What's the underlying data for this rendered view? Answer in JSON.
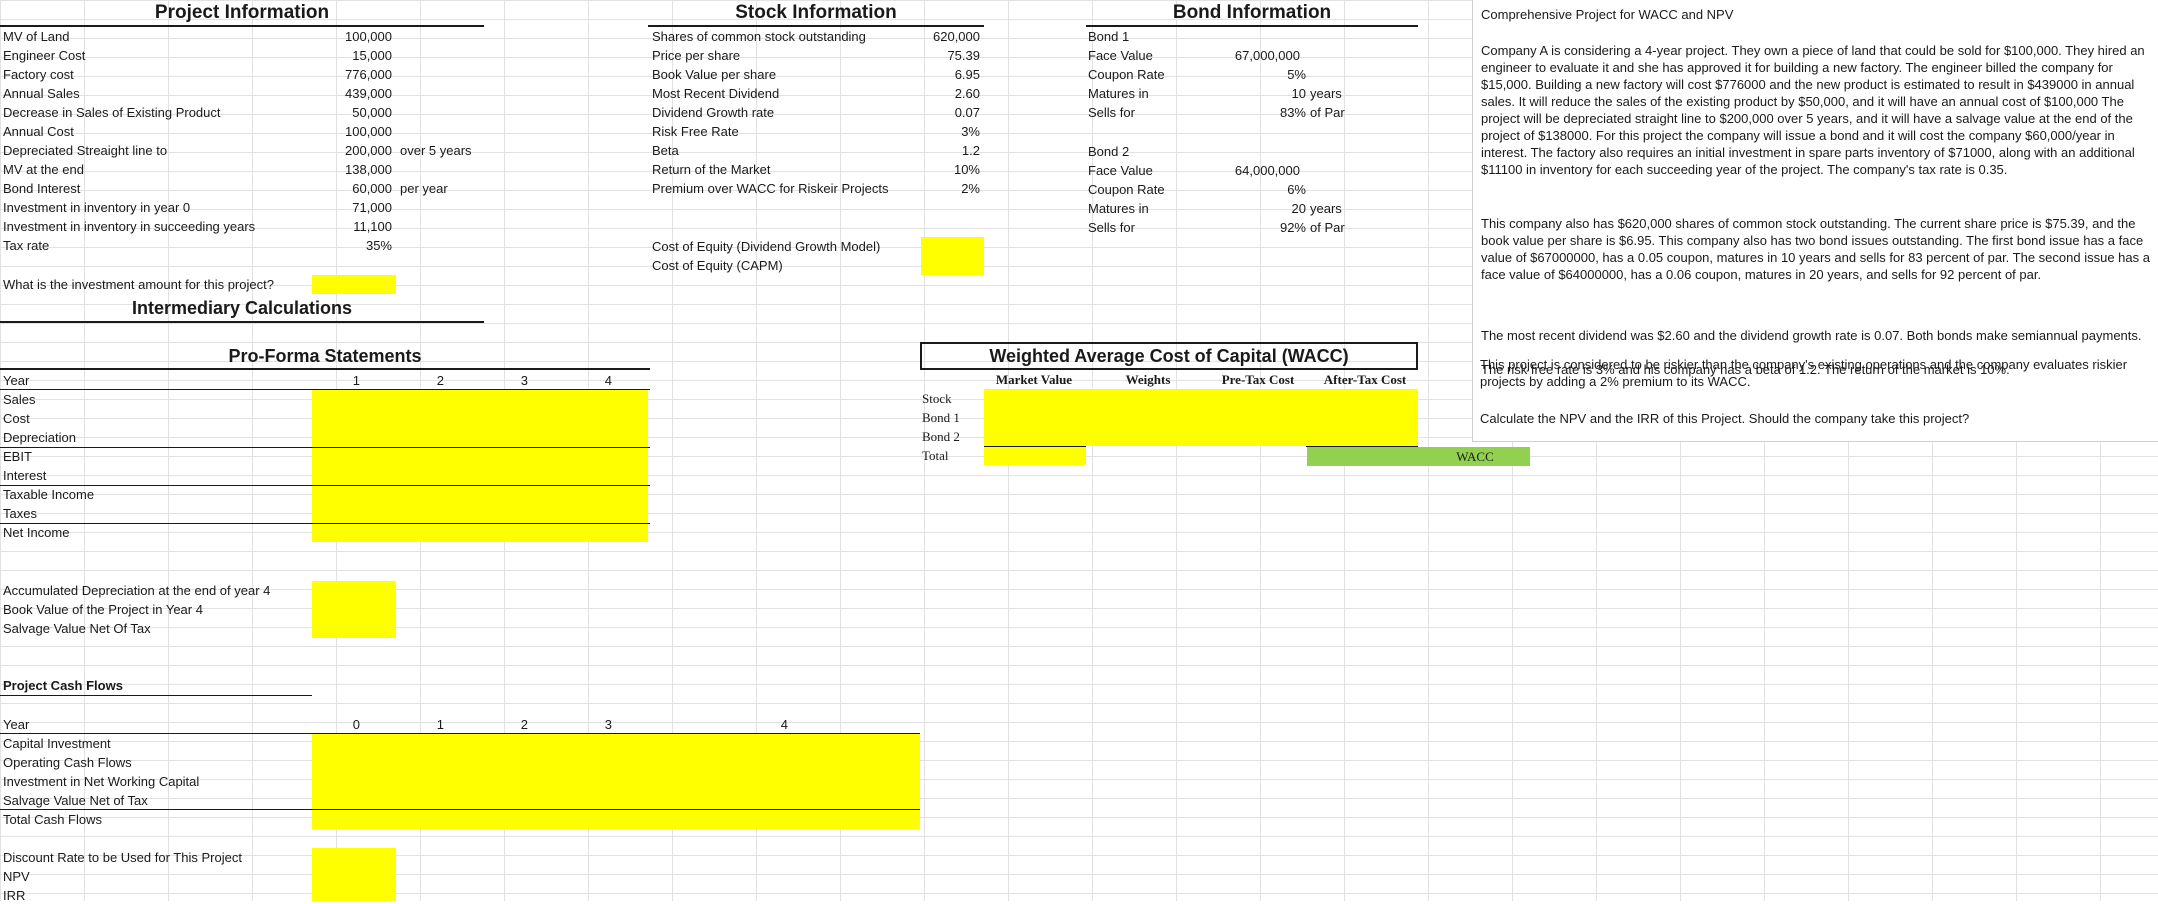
{
  "project": {
    "title": "Project Information",
    "rows": [
      {
        "label": "MV of Land",
        "value": "100,000",
        "unit": ""
      },
      {
        "label": "Engineer Cost",
        "value": "15,000",
        "unit": ""
      },
      {
        "label": "Factory cost",
        "value": "776,000",
        "unit": ""
      },
      {
        "label": "Annual Sales",
        "value": "439,000",
        "unit": ""
      },
      {
        "label": "Decrease in Sales of Existing Product",
        "value": "50,000",
        "unit": ""
      },
      {
        "label": "Annual Cost",
        "value": "100,000",
        "unit": ""
      },
      {
        "label": "Depreciated Streaight line to",
        "value": "200,000",
        "unit": "over 5 years"
      },
      {
        "label": "MV at the end",
        "value": "138,000",
        "unit": ""
      },
      {
        "label": "Bond Interest",
        "value": "60,000",
        "unit": "per year"
      },
      {
        "label": "Investment in inventory in year 0",
        "value": "71,000",
        "unit": ""
      },
      {
        "label": "Investment in inventory in succeeding years",
        "value": "11,100",
        "unit": ""
      },
      {
        "label": "Tax rate",
        "value": "35%",
        "unit": ""
      }
    ],
    "question": "What is the investment amount for this project?",
    "intermediary": "Intermediary Calculations"
  },
  "stock": {
    "title": "Stock Information",
    "rows": [
      {
        "label": "Shares of common stock outstanding",
        "value": "620,000"
      },
      {
        "label": "Price per share",
        "value": "75.39"
      },
      {
        "label": "Book Value per share",
        "value": "6.95"
      },
      {
        "label": "Most Recent Dividend",
        "value": "2.60"
      },
      {
        "label": "Dividend Growth rate",
        "value": "0.07"
      },
      {
        "label": "Risk Free Rate",
        "value": "3%"
      },
      {
        "label": "Beta",
        "value": "1.2"
      },
      {
        "label": "Return of the Market",
        "value": "10%"
      },
      {
        "label": "Premium over WACC for Riskeir Projects",
        "value": "2%"
      }
    ],
    "coe_ddm": "Cost of Equity (Dividend Growth Model)",
    "coe_capm": "Cost of Equity (CAPM)"
  },
  "bond": {
    "title": "Bond Information",
    "bonds": [
      {
        "name": "Bond 1",
        "face_label": "Face Value",
        "face": "67,000,000",
        "coupon_label": "Coupon Rate",
        "coupon": "5%",
        "mature_label": "Matures in",
        "mature": "10",
        "mature_unit": "years",
        "sells_label": "Sells for",
        "sells": "83%",
        "sells_unit": "of Par"
      },
      {
        "name": "Bond 2",
        "face_label": "Face Value",
        "face": "64,000,000",
        "coupon_label": "Coupon Rate",
        "coupon": "6%",
        "mature_label": "Matures in",
        "mature": "20",
        "mature_unit": "years",
        "sells_label": "Sells for",
        "sells": "92%",
        "sells_unit": "of Par"
      }
    ]
  },
  "note": {
    "title": "Comprehensive Project for WACC and NPV",
    "p1": "Company A is considering a 4-year project. They own a piece of land that could be sold for $100,000. They hired an engineer to evaluate it and she has approved it for building a new factory. The engineer billed the company for $15,000. Building a new factory will cost $776000 and the new product is estimated to result in $439000 in annual sales. It will reduce the sales of the existing product by $50,000, and it will have an annual cost of $100,000 The project will be depreciated straight line to $200,000 over 5 years, and it will have a salvage value at the end of the project of $138000. For this project the company will issue a bond and it will cost the company $60,000/year in interest. The factory also requires an initial investment in spare parts inventory of $71000, along with an additional $11100 in inventory for each succeeding year of the project. The company's tax rate is 0.35.",
    "p2": "This company also has $620,000 shares of common stock outstanding. The current share price is $75.39, and the book value per share is $6.95. This company also has two bond issues outstanding. The first bond issue has a face value of $67000000, has a 0.05 coupon, matures in 10 years and sells for 83 percent of par. The second issue has a face value of $64000000, has a 0.06 coupon, matures in 20 years, and sells for 92 percent of par.",
    "p3": "The most recent dividend was $2.60 and the dividend growth rate is 0.07. Both bonds make semiannual payments.",
    "p4": "The risk free rate is 3% and his company has a beta of 1.2. The return of the market is 10%.",
    "p5": "This project is considered to be riskier than the company's existing operations and the company evaluates riskier projects by adding a 2% premium to its WACC.",
    "p6": "Calculate the NPV and the IRR of this Project. Should the company take this project?"
  },
  "proforma": {
    "title": "Pro-Forma Statements",
    "year_label": "Year",
    "years": [
      "1",
      "2",
      "3",
      "4"
    ],
    "rows": [
      "Sales",
      "Cost",
      "Depreciation",
      "EBIT",
      "Interest",
      "Taxable Income",
      "Taxes",
      "Net Income"
    ]
  },
  "wacc": {
    "title": "Weighted Average Cost of Capital (WACC)",
    "headers": [
      "Market Value",
      "Weights",
      "Pre-Tax Cost",
      "After-Tax Cost"
    ],
    "rows": [
      "Stock",
      "Bond 1",
      "Bond 2",
      "Total"
    ],
    "label": "WACC"
  },
  "depr": {
    "rows": [
      "Accumulated Depreciation at the end of year 4",
      "Book Value of the Project in Year 4",
      "Salvage Value Net Of Tax"
    ]
  },
  "cashflows": {
    "title": "Project Cash Flows",
    "year_label": "Year",
    "years": [
      "0",
      "1",
      "2",
      "3",
      "4"
    ],
    "rows": [
      "Capital Investment",
      "Operating Cash Flows",
      "Investment in Net Working Capital",
      "Salvage Value Net of Tax",
      "Total Cash Flows"
    ]
  },
  "final": {
    "rows": [
      "Discount Rate to be Used for This Project",
      "NPV",
      "IRR"
    ]
  },
  "colors": {
    "highlight": "#ffff00",
    "wacc_cell": "#92d050",
    "gridline": "#e2e2e2"
  }
}
